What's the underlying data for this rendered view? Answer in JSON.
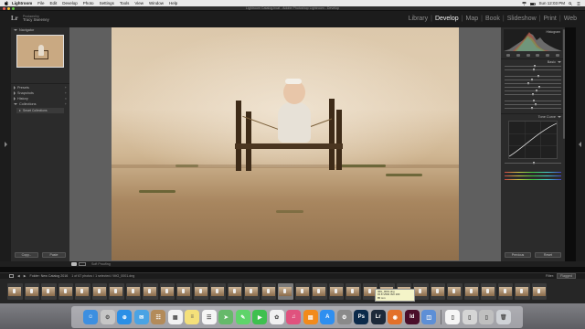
{
  "menubar": {
    "items": [
      "Lightroom",
      "File",
      "Edit",
      "Develop",
      "Photo",
      "Settings",
      "Tools",
      "View",
      "Window",
      "Help"
    ],
    "clock": "Sun 12:03 PM"
  },
  "window": {
    "title": "Lightroom Catalog.lrcat - Adobe Photoshop Lightroom - Develop"
  },
  "identity": {
    "logo": "Lr",
    "line1": "Produced by",
    "name": "Tracy Sweeney"
  },
  "modules": [
    "Library",
    "Develop",
    "Map",
    "Book",
    "Slideshow",
    "Print",
    "Web"
  ],
  "active_module": "Develop",
  "left_panel": {
    "navigator": "Navigator",
    "sections": [
      "Presets",
      "Snapshots",
      "History",
      "Collections"
    ],
    "collection_item": "Smart Collections",
    "copy_button": "Copy...",
    "paste_button": "Paste"
  },
  "right_panel": {
    "histogram_label": "Histogram",
    "basic_label": "Basic",
    "tone_curve_label": "Tone Curve",
    "previous_button": "Previous",
    "reset_button": "Reset"
  },
  "toolbar": {
    "soft_proofing": "Soft Proofing"
  },
  "filmstrip": {
    "path": "Folder: New Catalog 2016",
    "count": "1 of 67 photos / 1 selected / IMG_0001.dng",
    "filter_label": "Filter:",
    "filter_value": "Flagged",
    "tooltip": "IMG_0001.dng\nf/2.8 1/500 ISO 100\n85 mm"
  },
  "dock": {
    "apps": [
      {
        "name": "finder",
        "color": "#3d8fe0",
        "glyph": "☺"
      },
      {
        "name": "launchpad",
        "color": "#c6c6c6",
        "glyph": "⚙"
      },
      {
        "name": "safari",
        "color": "#2b8fe6",
        "glyph": "⊕"
      },
      {
        "name": "mail",
        "color": "#4aa3e4",
        "glyph": "✉"
      },
      {
        "name": "contacts",
        "color": "#b38b5a",
        "glyph": "☷"
      },
      {
        "name": "calendar",
        "color": "#f2f2f2",
        "glyph": "▦"
      },
      {
        "name": "notes",
        "color": "#f4e07a",
        "glyph": "≡"
      },
      {
        "name": "reminders",
        "color": "#f5f5f5",
        "glyph": "☰"
      },
      {
        "name": "maps",
        "color": "#66b96a",
        "glyph": "➤"
      },
      {
        "name": "messages",
        "color": "#5fd46a",
        "glyph": "✎"
      },
      {
        "name": "facetime",
        "color": "#3fc04f",
        "glyph": "▶"
      },
      {
        "name": "photos",
        "color": "#f1f1f1",
        "glyph": "✿"
      },
      {
        "name": "itunes",
        "color": "#e0527e",
        "glyph": "♫"
      },
      {
        "name": "ibooks",
        "color": "#f28a1b",
        "glyph": "▤"
      },
      {
        "name": "app-store",
        "color": "#2f8ff0",
        "glyph": "A"
      },
      {
        "name": "system-preferences",
        "color": "#8a8a8a",
        "glyph": "⚙"
      },
      {
        "name": "photoshop",
        "color": "#0b2a4a",
        "glyph": "Ps"
      },
      {
        "name": "lightroom",
        "color": "#1d2a3a",
        "glyph": "Lr"
      },
      {
        "name": "firefox",
        "color": "#e3702a",
        "glyph": "◉"
      },
      {
        "name": "indesign",
        "color": "#4a0e2a",
        "glyph": "Id"
      },
      {
        "name": "preview",
        "color": "#5d8fd6",
        "glyph": "◫"
      }
    ],
    "right_apps": [
      {
        "name": "document",
        "color": "#f5f5f5",
        "glyph": "▯"
      },
      {
        "name": "downloads",
        "color": "#d5d5d5",
        "glyph": "▯"
      },
      {
        "name": "folder",
        "color": "#bfbfbf",
        "glyph": "▯"
      },
      {
        "name": "trash",
        "color": "#cfd2d6",
        "glyph": "🗑"
      }
    ]
  }
}
